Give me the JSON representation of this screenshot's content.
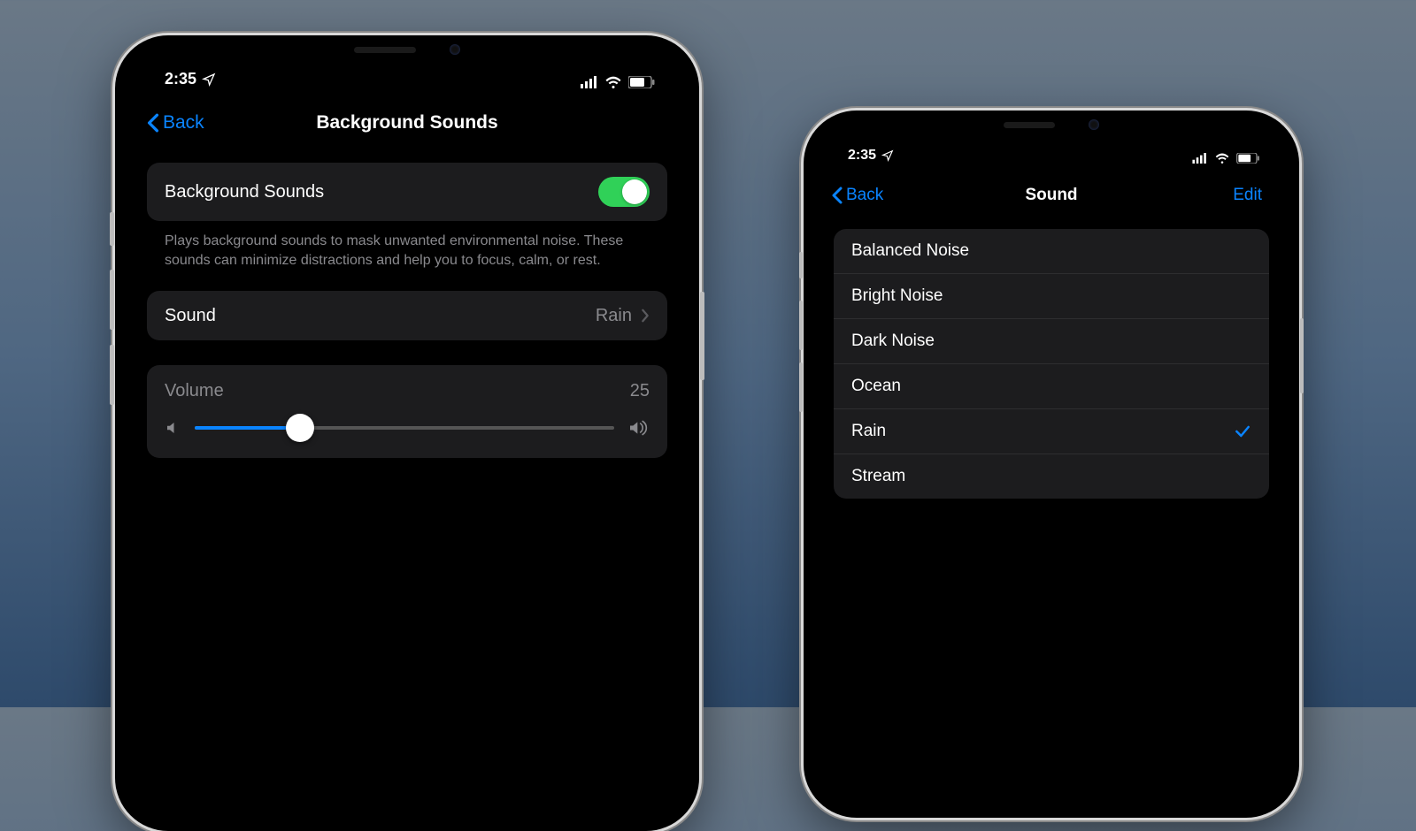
{
  "status": {
    "time": "2:35"
  },
  "colors": {
    "accent": "#0a84ff",
    "toggle_on": "#30d158",
    "secondary_text": "#8a8a8e",
    "cell_bg": "#1c1c1e"
  },
  "phone_left": {
    "nav": {
      "back": "Back",
      "title": "Background Sounds"
    },
    "toggle_row": {
      "label": "Background Sounds",
      "enabled": true
    },
    "description": "Plays background sounds to mask unwanted environmental noise. These sounds can minimize distractions and help you to focus, calm, or rest.",
    "sound_row": {
      "label": "Sound",
      "value": "Rain"
    },
    "volume": {
      "label": "Volume",
      "value": "25",
      "percent": 25
    }
  },
  "phone_right": {
    "nav": {
      "back": "Back",
      "title": "Sound",
      "edit": "Edit"
    },
    "options": [
      {
        "label": "Balanced Noise",
        "selected": false
      },
      {
        "label": "Bright Noise",
        "selected": false
      },
      {
        "label": "Dark Noise",
        "selected": false
      },
      {
        "label": "Ocean",
        "selected": false
      },
      {
        "label": "Rain",
        "selected": true
      },
      {
        "label": "Stream",
        "selected": false
      }
    ]
  }
}
